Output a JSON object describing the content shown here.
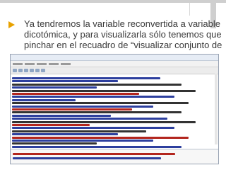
{
  "slide": {
    "bullet": {
      "lines": [
        "Ya tendremos la variable reconvertida a variable",
        "dicotómica, y para visualizarla sólo tenemos que",
        "pinchar en el recuadro de “visualizar conjunto de"
      ]
    }
  },
  "colors": {
    "bullet": "#e8a200",
    "text": "#3a3a3a",
    "code_blue": "#2d3f9e",
    "code_red": "#b3261e",
    "code_black": "#333333"
  },
  "screenshot": {
    "editor_lines": [
      {
        "color": "blue"
      },
      {
        "color": "blue"
      },
      {
        "color": "black"
      },
      {
        "color": "blue"
      },
      {
        "color": "black"
      },
      {
        "color": "red"
      },
      {
        "color": "blue"
      },
      {
        "color": "blue"
      },
      {
        "color": "black"
      },
      {
        "color": "blue"
      },
      {
        "color": "red"
      },
      {
        "color": "black"
      },
      {
        "color": "blue"
      },
      {
        "color": "blue"
      },
      {
        "color": "black"
      },
      {
        "color": "red"
      },
      {
        "color": "blue"
      },
      {
        "color": "black"
      },
      {
        "color": "blue"
      },
      {
        "color": "red"
      },
      {
        "color": "blue"
      },
      {
        "color": "black"
      },
      {
        "color": "blue"
      }
    ],
    "console_lines": [
      {
        "color": "red"
      },
      {
        "color": "blue"
      }
    ]
  }
}
